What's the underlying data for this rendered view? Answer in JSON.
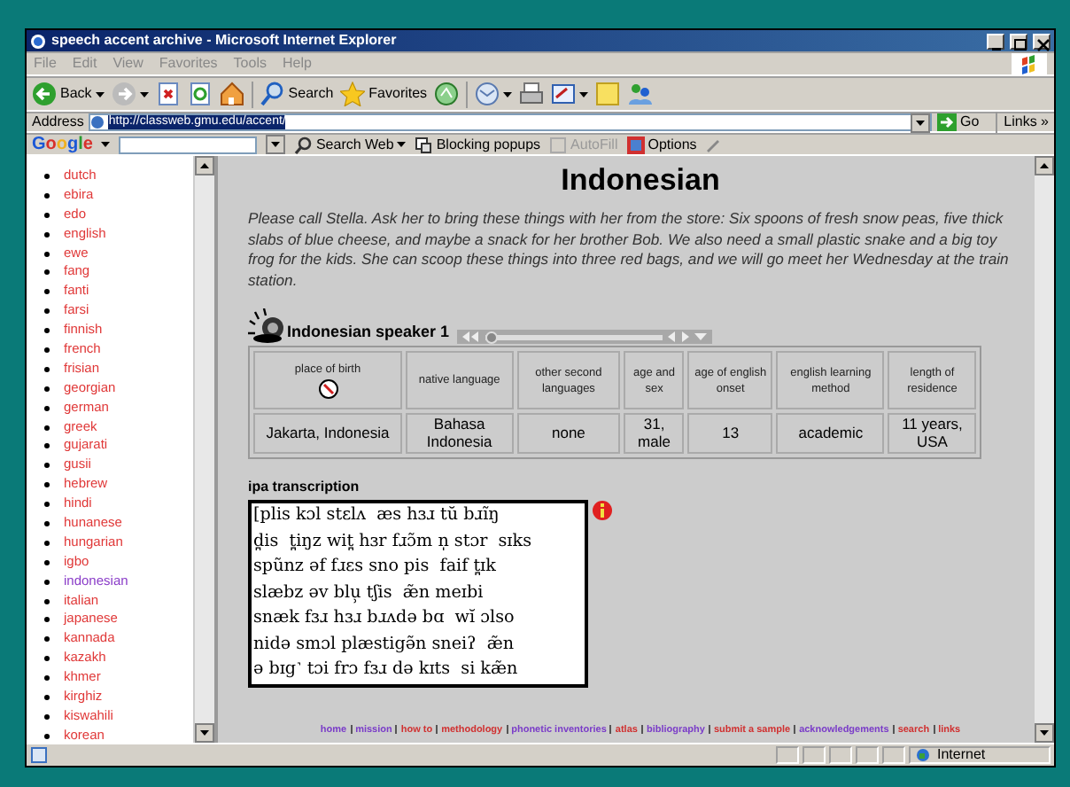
{
  "window": {
    "title": "speech accent archive - Microsoft Internet Explorer"
  },
  "menu": [
    "File",
    "Edit",
    "View",
    "Favorites",
    "Tools",
    "Help"
  ],
  "toolbar": [
    {
      "kind": "back",
      "label": "Back",
      "dropdown": true
    },
    {
      "kind": "forward",
      "dropdown": true
    },
    {
      "kind": "stop"
    },
    {
      "kind": "refresh"
    },
    {
      "kind": "home"
    },
    {
      "kind": "search",
      "label": "Search"
    },
    {
      "kind": "favorites",
      "label": "Favorites"
    },
    {
      "kind": "media"
    },
    {
      "kind": "mail",
      "dropdown": true
    },
    {
      "kind": "print"
    },
    {
      "kind": "edit",
      "dropdown": true
    },
    {
      "kind": "note"
    },
    {
      "kind": "messenger"
    }
  ],
  "address": {
    "label": "Address",
    "url": "http://classweb.gmu.edu/accent/",
    "go": "Go",
    "links": "Links",
    "more": "»"
  },
  "google_bar": {
    "logo": "Google",
    "search_web": "Search Web",
    "blocking": "Blocking popups",
    "autofill": {
      "label": "AutoFill",
      "disabled": true
    },
    "options": "Options"
  },
  "sidebar": {
    "languages": [
      {
        "name": "dutch",
        "visited": false
      },
      {
        "name": "ebira",
        "visited": false
      },
      {
        "name": "edo",
        "visited": false
      },
      {
        "name": "english",
        "visited": false
      },
      {
        "name": "ewe",
        "visited": false
      },
      {
        "name": "fang",
        "visited": false
      },
      {
        "name": "fanti",
        "visited": false
      },
      {
        "name": "farsi",
        "visited": false
      },
      {
        "name": "finnish",
        "visited": false
      },
      {
        "name": "french",
        "visited": false
      },
      {
        "name": "frisian",
        "visited": false
      },
      {
        "name": "georgian",
        "visited": false
      },
      {
        "name": "german",
        "visited": false
      },
      {
        "name": "greek",
        "visited": false
      },
      {
        "name": "gujarati",
        "visited": false
      },
      {
        "name": "gusii",
        "visited": false
      },
      {
        "name": "hebrew",
        "visited": false
      },
      {
        "name": "hindi",
        "visited": false
      },
      {
        "name": "hunanese",
        "visited": false
      },
      {
        "name": "hungarian",
        "visited": false
      },
      {
        "name": "igbo",
        "visited": false
      },
      {
        "name": "indonesian",
        "visited": true
      },
      {
        "name": "italian",
        "visited": false
      },
      {
        "name": "japanese",
        "visited": false
      },
      {
        "name": "kannada",
        "visited": false
      },
      {
        "name": "kazakh",
        "visited": false
      },
      {
        "name": "khmer",
        "visited": false
      },
      {
        "name": "kirghiz",
        "visited": false
      },
      {
        "name": "kiswahili",
        "visited": false
      },
      {
        "name": "korean",
        "visited": false
      }
    ]
  },
  "page": {
    "title": "Indonesian",
    "passage": "Please call Stella.  Ask her to bring these things with her from the store:  Six spoons of fresh snow peas, five thick slabs of blue cheese, and maybe a snack for her brother Bob.  We also need a small plastic snake and a big toy frog for the kids.  She can scoop these things into three red bags, and we will go meet her Wednesday at the train station.",
    "speaker": {
      "label": "Indonesian speaker 1",
      "level": 0.03
    },
    "table": {
      "columns": [
        "place of birth",
        "native language",
        "other second languages",
        "age and sex",
        "age of english onset",
        "english learning method",
        "length of residence"
      ],
      "rows": [
        [
          "Jakarta, Indonesia",
          "Bahasa Indonesia",
          "none",
          "31, male",
          "13",
          "academic",
          "11 years, USA"
        ]
      ]
    },
    "ipa": {
      "label": "ipa transcription",
      "lines": [
        "[plis kɔl stɛlʌ  æs hɜɹ tŭ bɹĩŋ",
        "d̪is  t̪iŋz wit̪ hɜr fɹɔ̃m n̩ stɔr  sɪks",
        "spũnz əf fɹɛs sno pis  faif t̪ɪk",
        "slæbz əv blu̹ tʃis  æ̃n meɪbi",
        "snæk fɜɹ hɜɹ bɹʌdə bɑ  wĭ ɔlso",
        "nidə smɔl plæstigə̃n sneiʔ  æ̃n",
        "ə bɪg˺ tɔi frɔ fɜɹ də kɪts  si kæ̃n"
      ]
    }
  },
  "footer_links": [
    {
      "label": "home",
      "visited": true
    },
    {
      "label": "mission",
      "visited": true
    },
    {
      "label": "how to",
      "visited": false
    },
    {
      "label": "methodology",
      "visited": false
    },
    {
      "label": "phonetic inventories",
      "visited": true
    },
    {
      "label": "atlas",
      "visited": false
    },
    {
      "label": "bibliography",
      "visited": true
    },
    {
      "label": "submit a sample",
      "visited": false
    },
    {
      "label": "acknowledgements",
      "visited": true
    },
    {
      "label": "search",
      "visited": false
    },
    {
      "label": "links",
      "visited": false
    }
  ],
  "status_bar": {
    "zone": "Internet"
  }
}
